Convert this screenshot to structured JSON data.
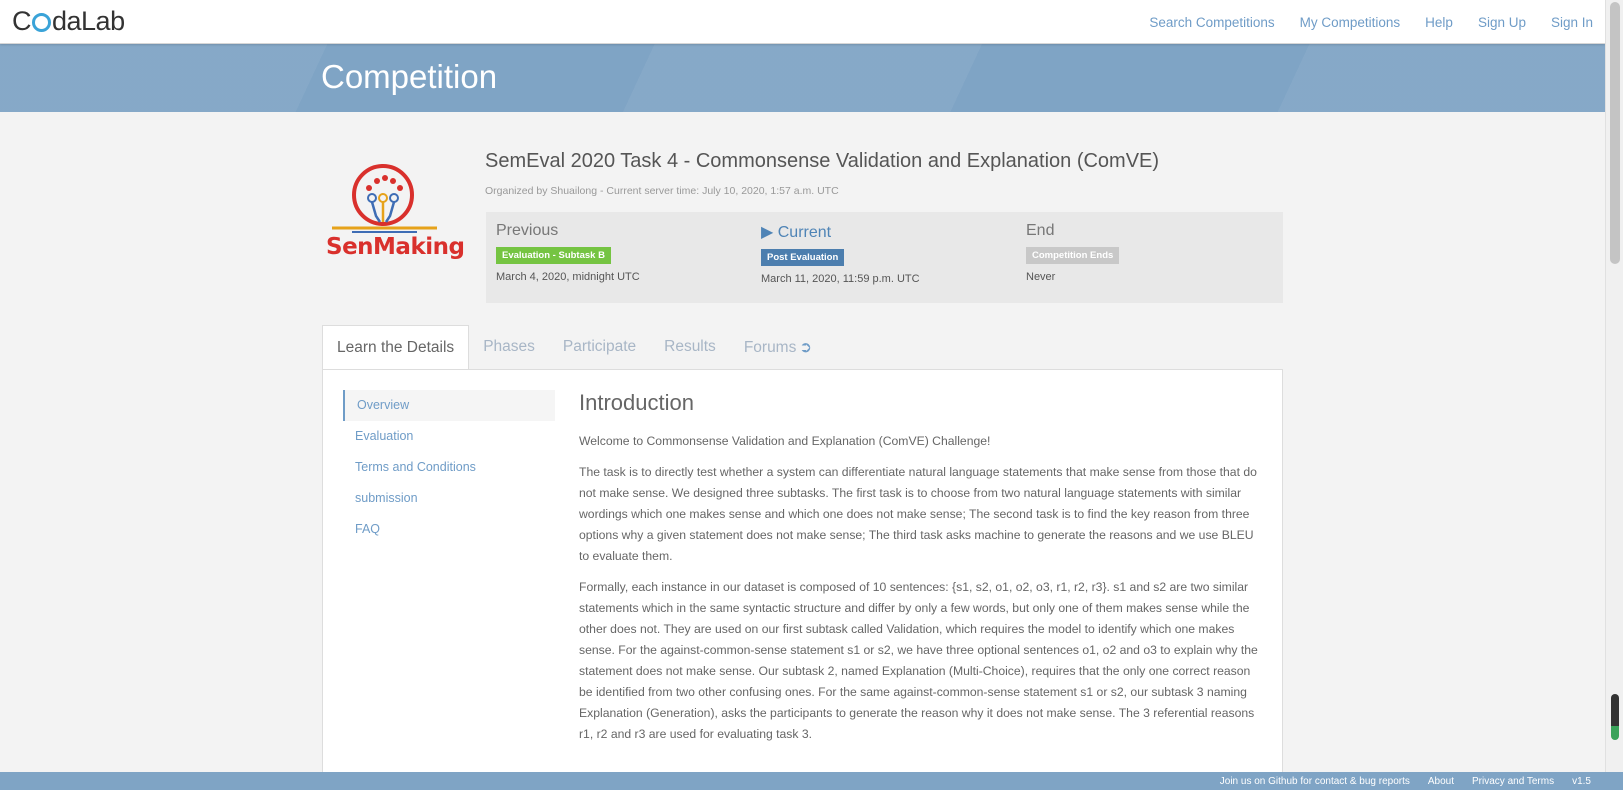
{
  "brand": {
    "name_prefix": "C",
    "name_suffix": "daLab"
  },
  "nav": [
    {
      "label": "Search Competitions"
    },
    {
      "label": "My Competitions"
    },
    {
      "label": "Help"
    },
    {
      "label": "Sign Up"
    },
    {
      "label": "Sign In"
    }
  ],
  "banner": {
    "title": "Competition"
  },
  "competition": {
    "logo_text": "SenMaking",
    "title": "SemEval 2020 Task 4 - Commonsense Validation and Explanation (ComVE)",
    "organizer": "Organized by Shuailong - Current server time: July 10, 2020, 1:57 a.m. UTC"
  },
  "phases": [
    {
      "name": "Previous",
      "badge": "Evaluation - Subtask B",
      "date": "March 4, 2020, midnight UTC"
    },
    {
      "name": "▶ Current",
      "badge": "Post Evaluation",
      "date": "March 11, 2020, 11:59 p.m. UTC"
    },
    {
      "name": "End",
      "badge": "Competition Ends",
      "date": "Never"
    }
  ],
  "tabs": [
    {
      "label": "Learn the Details"
    },
    {
      "label": "Phases"
    },
    {
      "label": "Participate"
    },
    {
      "label": "Results"
    },
    {
      "label": "Forums"
    }
  ],
  "sidenav": [
    {
      "label": "Overview"
    },
    {
      "label": "Evaluation"
    },
    {
      "label": "Terms and Conditions"
    },
    {
      "label": "submission"
    },
    {
      "label": "FAQ"
    }
  ],
  "content": {
    "heading": "Introduction",
    "paragraphs": [
      "Welcome to Commonsense Validation and Explanation (ComVE) Challenge!",
      "The task is to directly test whether a system can differentiate natural language statements that make sense from those that do not make sense. We designed three subtasks. The first task is to choose from two natural language statements with similar wordings which one makes sense and which one does not make sense; The second task is to find the key reason from three options why a given statement does not make sense; The third task asks machine to generate the reasons and we use BLEU to evaluate them.",
      "Formally, each instance in our dataset is composed of 10 sentences: {s1, s2, o1, o2, o3, r1, r2, r3}. s1 and s2 are two similar statements which in the same syntactic structure and differ by only a few words, but only one of them makes sense while the other does not. They are used on our first subtask called Validation, which requires the model to identify which one makes sense. For the against-common-sense statement s1 or s2, we have three optional sentences o1, o2 and o3 to explain why the statement does not make sense. Our subtask 2, named Explanation (Multi-Choice), requires that the only one correct reason be identified from two other confusing ones. For the same against-common-sense statement s1 or s2, our subtask 3 naming Explanation (Generation), asks the participants to generate the reason why it does not make sense. The 3 referential reasons r1, r2 and r3 are used for evaluating task 3."
    ]
  },
  "footer": [
    {
      "label": "Join us on Github for contact & bug reports"
    },
    {
      "label": "About"
    },
    {
      "label": "Privacy and Terms"
    },
    {
      "label": "v1.5"
    }
  ],
  "colors": {
    "accent": "#6f9cc7",
    "banner": "#7fa4c5",
    "green": "#75c442",
    "blue": "#4c7eae",
    "logo_red": "#d9302c"
  }
}
